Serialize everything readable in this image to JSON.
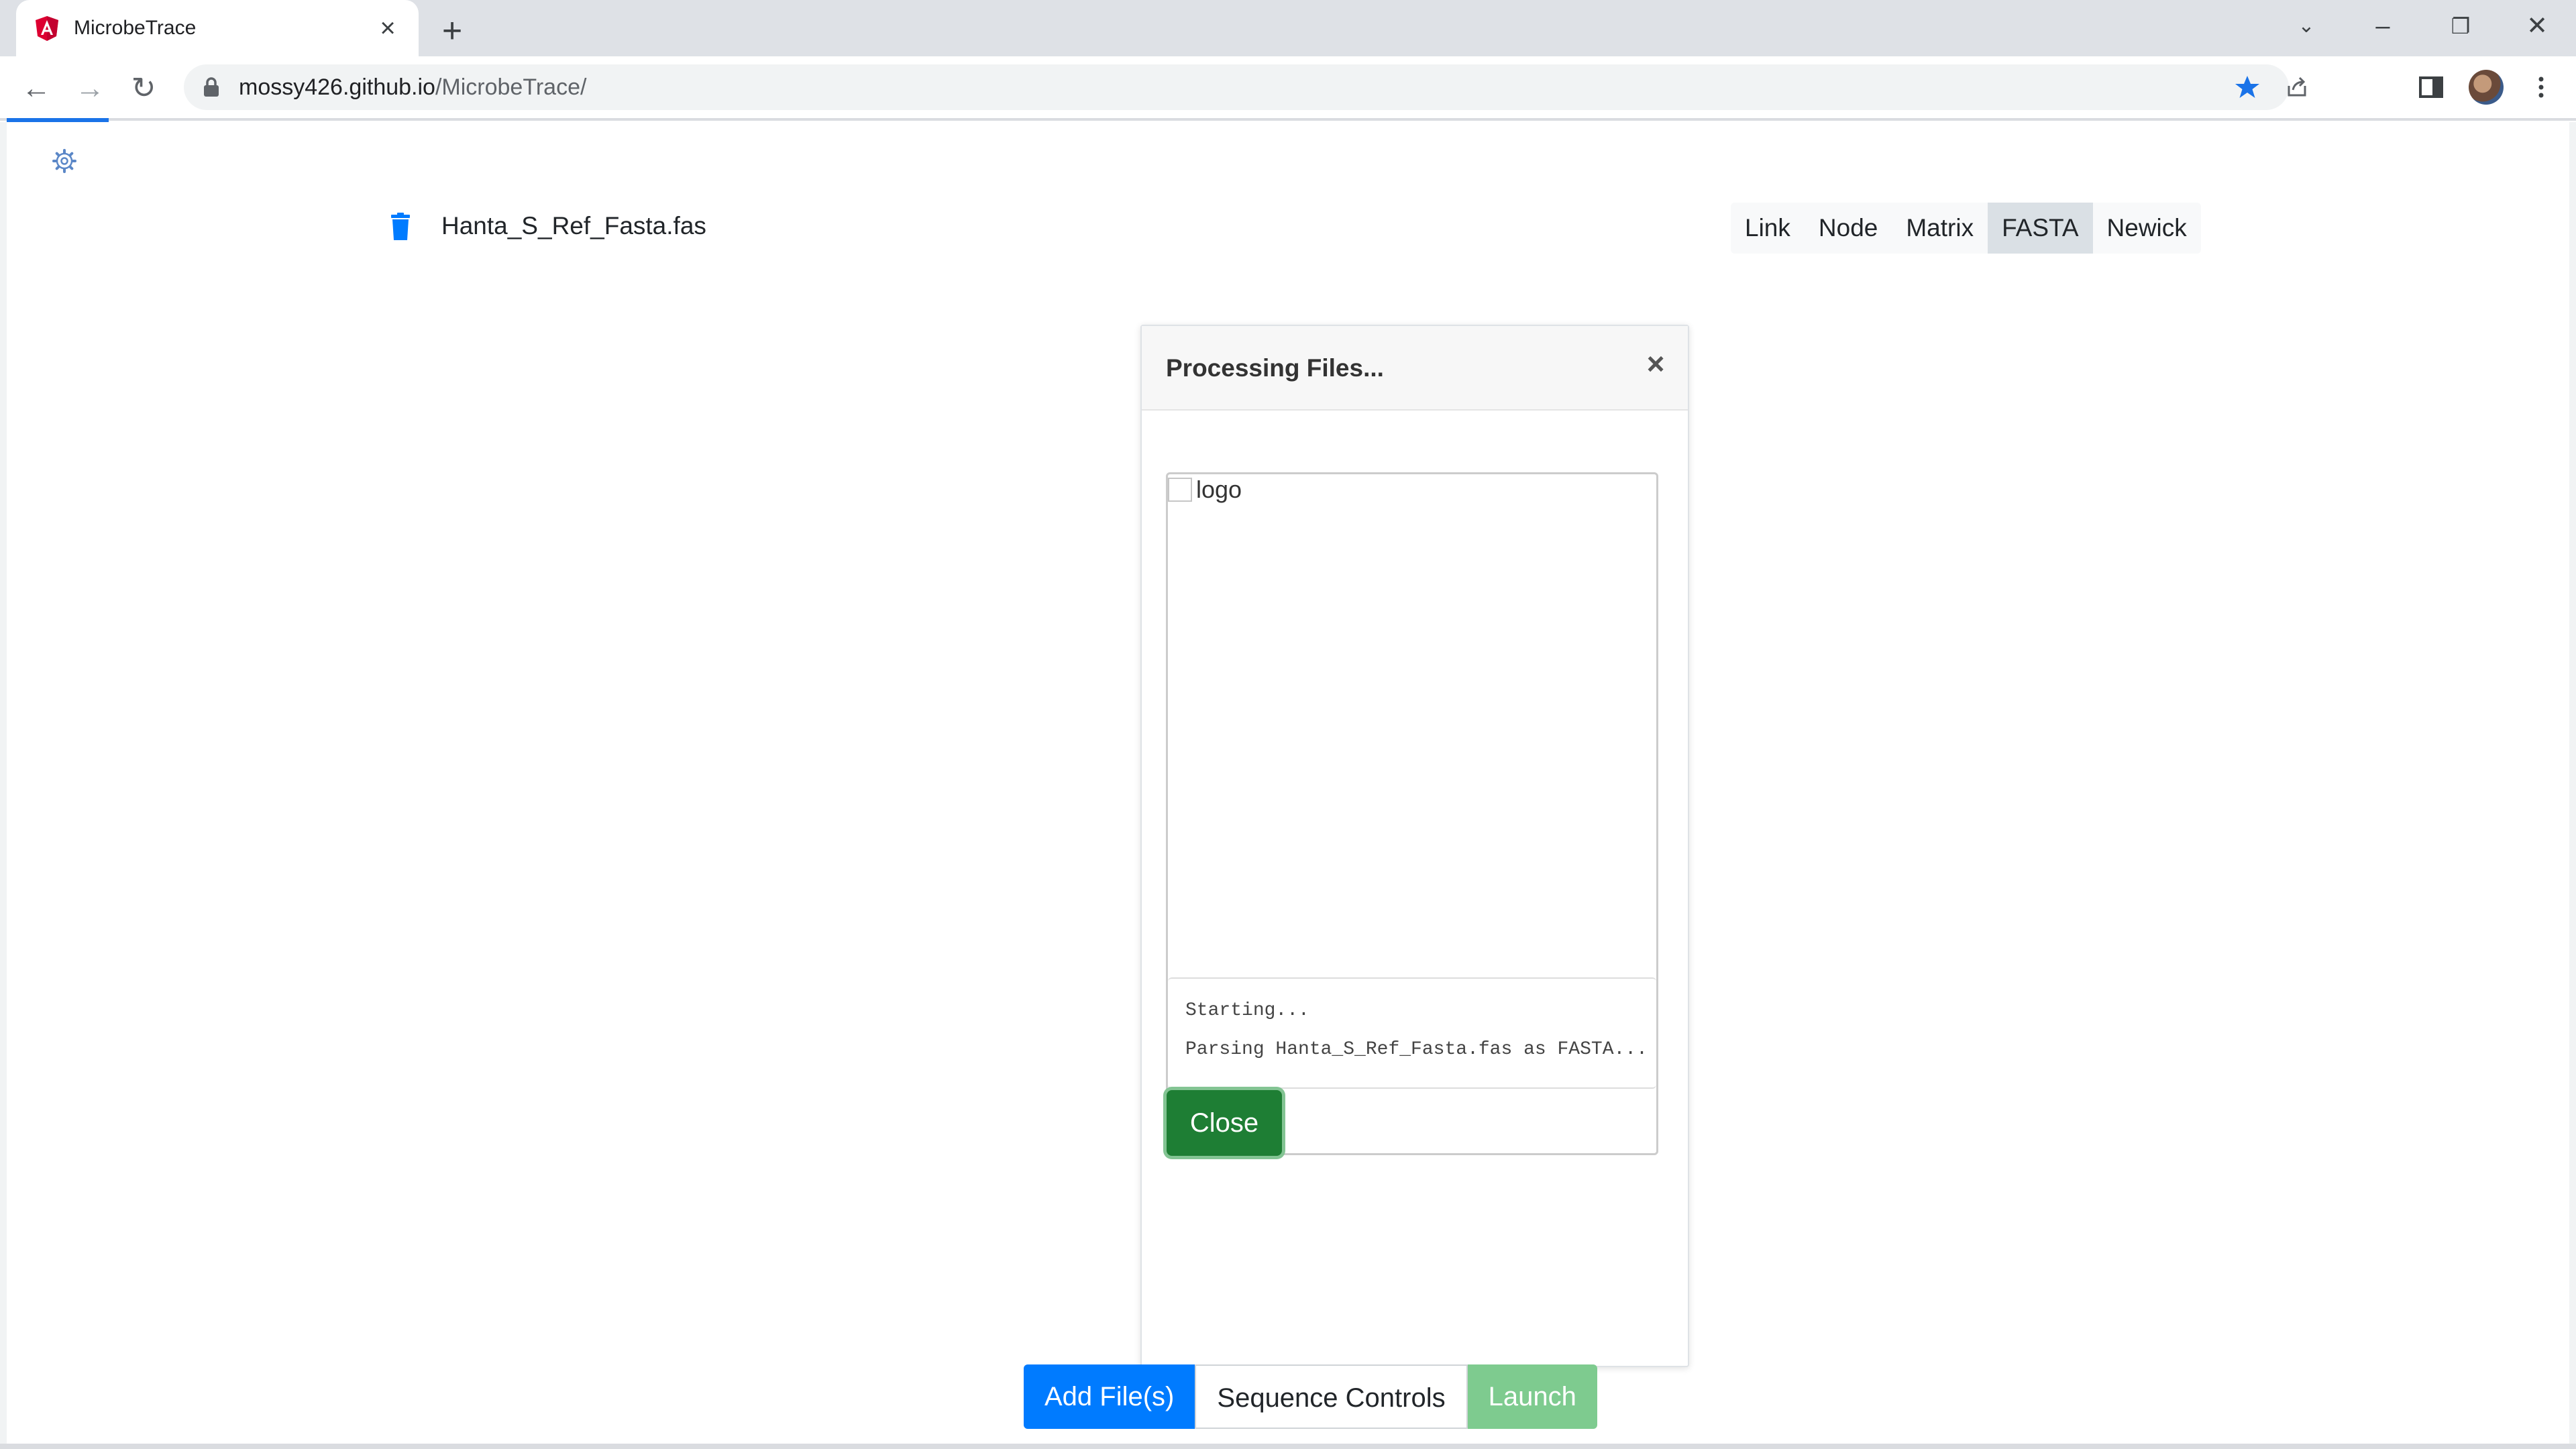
{
  "browser": {
    "tab_title": "MicrobeTrace",
    "url_domain": "mossy426.github.io",
    "url_path": "/MicrobeTrace/",
    "brand_color": "#dd0031",
    "accent_color": "#1a73e8"
  },
  "page": {
    "file": {
      "name": "Hanta_S_Ref_Fasta.fas"
    },
    "file_types": [
      {
        "label": "Link"
      },
      {
        "label": "Node"
      },
      {
        "label": "Matrix"
      },
      {
        "label": "FASTA",
        "active": true
      },
      {
        "label": "Newick"
      }
    ],
    "modal": {
      "title": "Processing Files...",
      "close_symbol": "×",
      "logo_alt": "logo",
      "log_lines": [
        "Starting...",
        "Parsing Hanta_S_Ref_Fasta.fas as FASTA..."
      ],
      "close_button": "Close"
    },
    "buttons": {
      "add_files": "Add File(s)",
      "sequence_controls": "Sequence Controls",
      "launch": "Launch"
    }
  }
}
